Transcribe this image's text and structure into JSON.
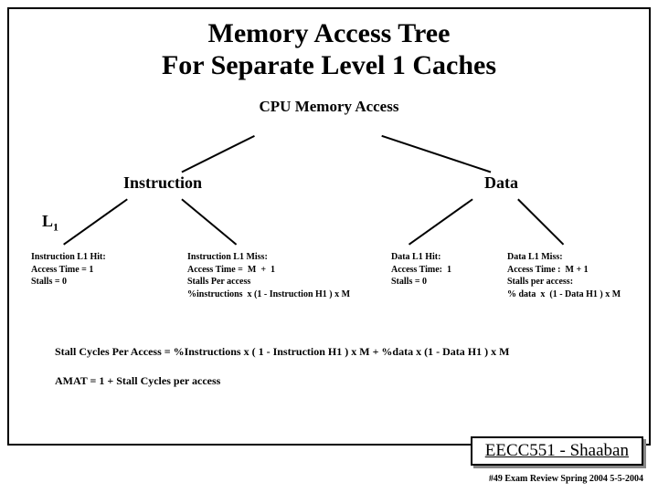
{
  "title_line1": "Memory Access Tree",
  "title_line2": "For Separate Level 1 Caches",
  "root": "CPU Memory  Access",
  "instruction": "Instruction",
  "data": "Data",
  "l1_label_pre": "L",
  "l1_label_sub": "1",
  "leaves": {
    "instr_hit": "Instruction L1 Hit:\nAccess Time = 1\nStalls = 0",
    "instr_miss": "Instruction L1 Miss:\nAccess Time =  M  +  1\nStalls Per access\n%instructions  x (1 - Instruction H1 ) x M",
    "data_hit": "Data L1 Hit:\nAccess Time:  1\nStalls = 0",
    "data_miss": "Data L1 Miss:\nAccess Time :  M + 1\nStalls per access:\n% data  x  (1 - Data H1 ) x M"
  },
  "formula1": "Stall Cycles Per Access =   %Instructions  x ( 1 - Instruction H1 ) x M  +   %data  x  (1 - Data H1 ) x M",
  "formula2": "AMAT  =  1 +  Stall Cycles per access",
  "footer": "EECC551 - Shaaban",
  "slide_info": "#49   Exam Review  Spring 2004  5-5-2004"
}
